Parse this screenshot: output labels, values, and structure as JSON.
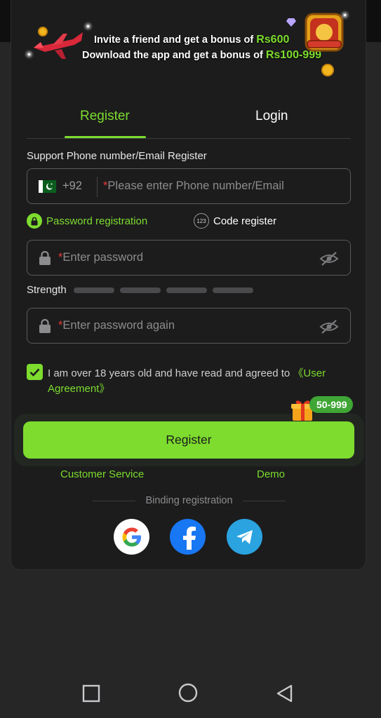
{
  "banner": {
    "line1_prefix": "Invite a friend and get a bonus of",
    "line1_amount": "Rs600",
    "line2_prefix": "Download the app and get a bonus of",
    "line2_amount": "Rs100-999"
  },
  "tabs": [
    {
      "label": "Register",
      "active": true
    },
    {
      "label": "Login",
      "active": false
    }
  ],
  "form": {
    "support_label": "Support Phone number/Email Register",
    "country_code": "+92",
    "required_mark": "*",
    "phone_placeholder": "Please enter Phone number/Email",
    "mode_password_label": "Password registration",
    "mode_code_label": "Code register",
    "code_icon_text": "123",
    "password_placeholder": "Enter password",
    "strength_label": "Strength",
    "password_again_placeholder": "Enter password again",
    "agreement_text": "I am over 18 years old and have read and agreed to ",
    "agreement_link": "《User Agreement》",
    "agreement_checked": true
  },
  "register_button": {
    "label": "Register",
    "bonus_badge": "50-999"
  },
  "links": {
    "customer_service": "Customer Service",
    "demo": "Demo"
  },
  "binding": {
    "label": "Binding registration",
    "providers": [
      "google-icon",
      "facebook-icon",
      "telegram-icon"
    ]
  },
  "colors": {
    "accent": "#7ddc2e",
    "background": "#1c1c1d",
    "required": "#e53935"
  }
}
